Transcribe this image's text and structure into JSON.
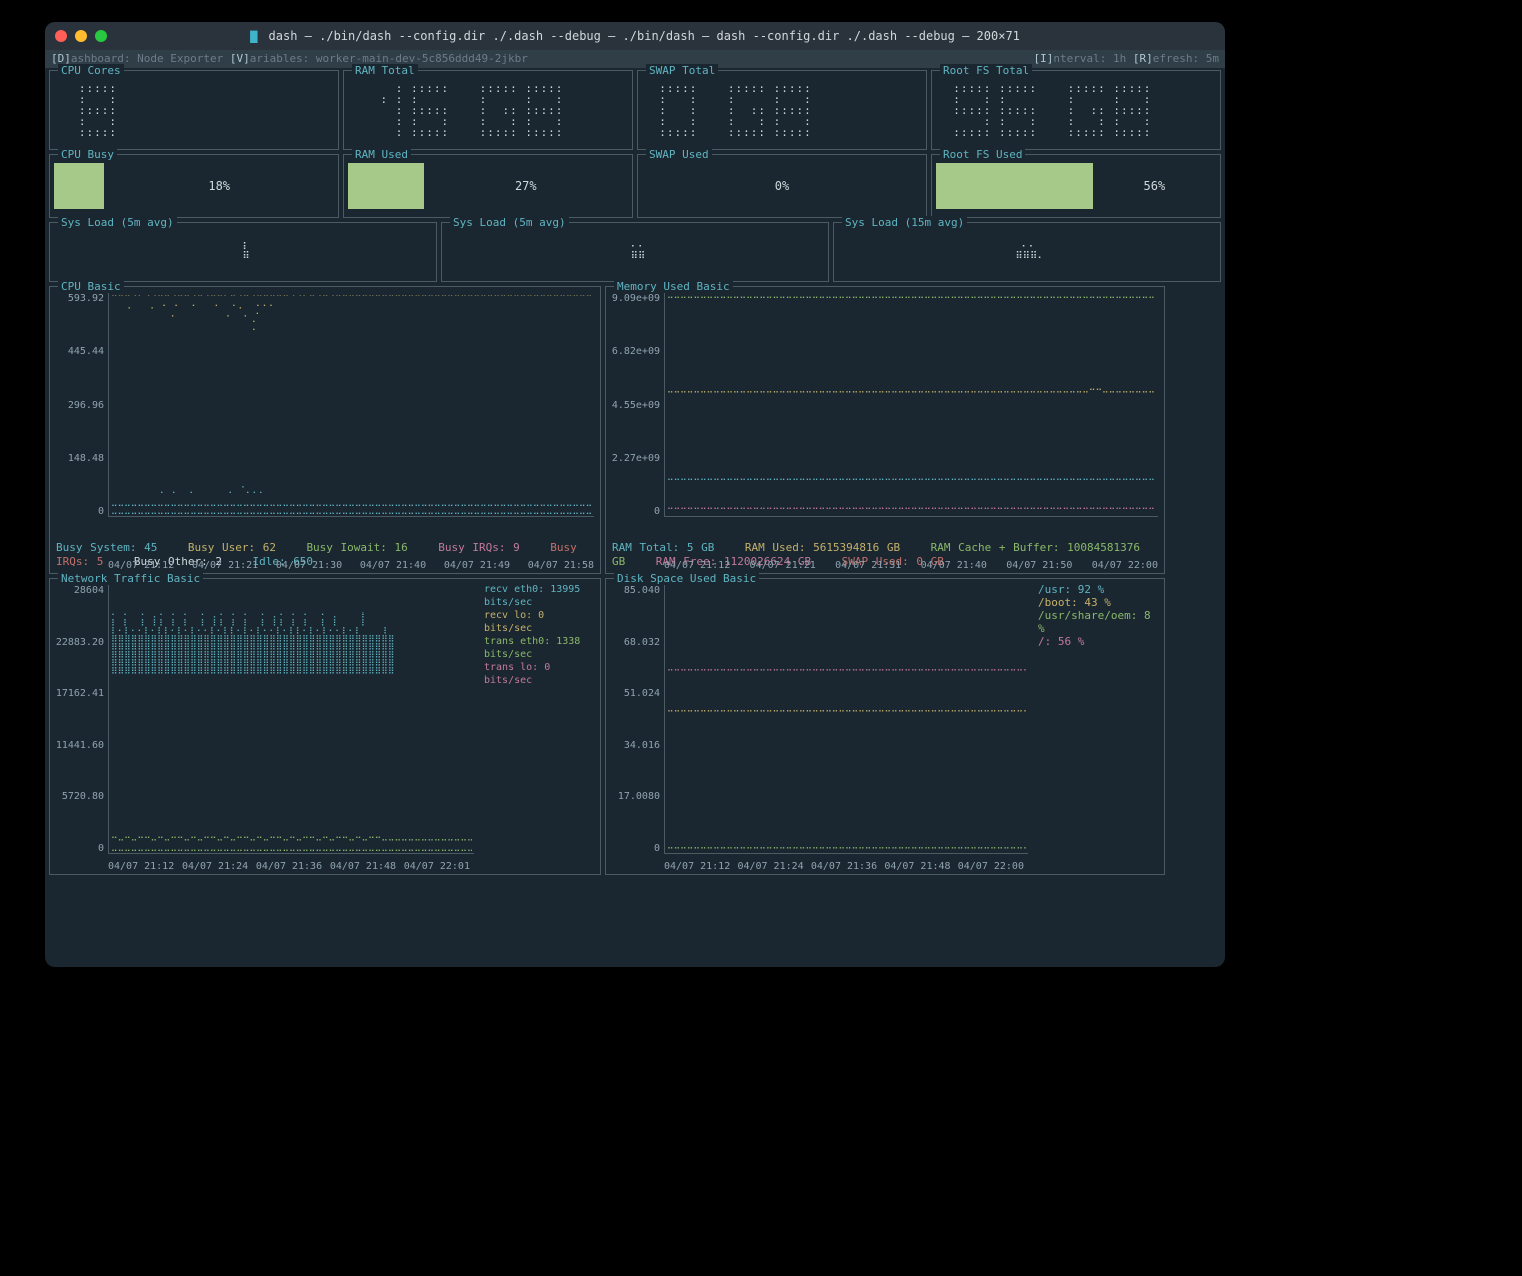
{
  "window": {
    "title": "dash — ./bin/dash --config.dir ./.dash --debug — ./bin/dash — dash --config.dir ./.dash --debug — 200×71"
  },
  "topbar": {
    "left_dashboard_key": "[D]",
    "left_dashboard": "ashboard: Node Exporter ",
    "left_variables_key": "[V]",
    "left_variables": "ariables: worker-main-dev-5c856ddd49-2jkbr",
    "right_interval_key": "[I]",
    "right_interval": "nterval: 1h ",
    "right_refresh_key": "[R]",
    "right_refresh": "efresh: 5m"
  },
  "big_panels": {
    "cpu_cores": {
      "title": "CPU Cores",
      "value": "8"
    },
    "ram_total": {
      "title": "RAM Total",
      "value": "16 GB"
    },
    "swap_total": {
      "title": "SWAP Total",
      "value": "0 GB"
    },
    "root_fs_total": {
      "title": "Root FS Total",
      "value": "96 GB"
    }
  },
  "gauges": {
    "cpu_busy": {
      "title": "CPU Busy",
      "pct": 18,
      "label": "18%"
    },
    "ram_used": {
      "title": "RAM Used",
      "pct": 27,
      "label": "27%"
    },
    "swap_used": {
      "title": "SWAP Used",
      "pct": 0,
      "label": "0%"
    },
    "root_fs_used": {
      "title": "Root FS Used",
      "pct": 56,
      "label": "56%"
    }
  },
  "sysload": {
    "a": {
      "title": "Sys Load (5m avg)"
    },
    "b": {
      "title": "Sys Load (5m avg)"
    },
    "c": {
      "title": "Sys Load (15m avg)"
    }
  },
  "cpu_basic": {
    "title": "CPU Basic",
    "y_ticks": [
      "593.92",
      "445.44",
      "296.96",
      "148.48",
      "0"
    ],
    "x_ticks": [
      "04/07 21:12",
      "04/07 21:21",
      "04/07 21:30",
      "04/07 21:40",
      "04/07 21:49",
      "04/07 21:58"
    ],
    "legend": [
      {
        "cls": "lg-cyan",
        "text": "Busy System: 45"
      },
      {
        "cls": "lg-yellow",
        "text": "Busy User: 62"
      },
      {
        "cls": "lg-green",
        "text": "Busy Iowait: 16"
      },
      {
        "cls": "lg-mag",
        "text": "Busy IRQs: 9"
      },
      {
        "cls": "lg-red",
        "text": "Busy IRQs: 5"
      },
      {
        "cls": "lg-white",
        "text": "Busy Other: 2"
      },
      {
        "cls": "lg-cyan",
        "text": "Idle: 650"
      }
    ]
  },
  "mem_basic": {
    "title": "Memory Used Basic",
    "y_ticks": [
      "9.09e+09",
      "6.82e+09",
      "4.55e+09",
      "2.27e+09",
      "0"
    ],
    "x_ticks": [
      "04/07 21:12",
      "04/07 21:21",
      "04/07 21:31",
      "04/07 21:40",
      "04/07 21:50",
      "04/07 22:00"
    ],
    "legend": [
      {
        "cls": "lg-cyan",
        "text": "RAM Total: 5 GB"
      },
      {
        "cls": "lg-yellow",
        "text": "RAM Used: 5615394816 GB"
      },
      {
        "cls": "lg-green",
        "text": "RAM Cache + Buffer: 10084581376 GB"
      },
      {
        "cls": "lg-mag",
        "text": "RAM Free: 1120026624 GB"
      },
      {
        "cls": "lg-red",
        "text": "SWAP Used: 0 GB"
      }
    ]
  },
  "net_basic": {
    "title": "Network Traffic Basic",
    "y_ticks": [
      "28604",
      "22883.20",
      "17162.41",
      "11441.60",
      "5720.80",
      "0"
    ],
    "x_ticks": [
      "04/07 21:12",
      "04/07 21:24",
      "04/07 21:36",
      "04/07 21:48",
      "04/07 22:01"
    ],
    "legend": [
      {
        "cls": "lg-cyan",
        "text": "recv eth0: 13995 bits/sec"
      },
      {
        "cls": "lg-yellow",
        "text": "recv lo: 0 bits/sec"
      },
      {
        "cls": "lg-green",
        "text": "trans eth0: 1338 bits/sec"
      },
      {
        "cls": "lg-mag",
        "text": "trans lo: 0 bits/sec"
      }
    ]
  },
  "disk_basic": {
    "title": "Disk Space Used Basic",
    "y_ticks": [
      "85.040",
      "68.032",
      "51.024",
      "34.016",
      "17.0080",
      "0"
    ],
    "x_ticks": [
      "04/07 21:12",
      "04/07 21:24",
      "04/07 21:36",
      "04/07 21:48",
      "04/07 22:00"
    ],
    "legend": [
      {
        "cls": "lg-cyan",
        "text": "/usr: 92 %"
      },
      {
        "cls": "lg-yellow",
        "text": "/boot: 43 %"
      },
      {
        "cls": "lg-green",
        "text": "/usr/share/oem: 8 %"
      },
      {
        "cls": "lg-mag",
        "text": "/: 56 %"
      }
    ]
  },
  "chart_data": [
    {
      "type": "line",
      "title": "CPU Basic",
      "xlabel": "",
      "ylabel": "",
      "ylim": [
        0,
        593.92
      ],
      "x": [
        "04/07 21:12",
        "04/07 21:21",
        "04/07 21:30",
        "04/07 21:40",
        "04/07 21:49",
        "04/07 21:58"
      ],
      "series": [
        {
          "name": "Busy System",
          "values": [
            45,
            45,
            45,
            45,
            45,
            45
          ]
        },
        {
          "name": "Busy User",
          "values": [
            62,
            62,
            62,
            62,
            62,
            62
          ]
        },
        {
          "name": "Busy Iowait",
          "values": [
            16,
            16,
            16,
            16,
            16,
            16
          ]
        },
        {
          "name": "Busy IRQs",
          "values": [
            9,
            9,
            9,
            9,
            9,
            9
          ]
        },
        {
          "name": "Busy IRQs2",
          "values": [
            5,
            5,
            5,
            5,
            5,
            5
          ]
        },
        {
          "name": "Busy Other",
          "values": [
            2,
            2,
            2,
            2,
            2,
            2
          ]
        },
        {
          "name": "Idle",
          "values": [
            650,
            580,
            560,
            540,
            590,
            590
          ]
        }
      ]
    },
    {
      "type": "line",
      "title": "Memory Used Basic",
      "ylim": [
        0,
        9090000000.0
      ],
      "x": [
        "04/07 21:12",
        "04/07 21:21",
        "04/07 21:31",
        "04/07 21:40",
        "04/07 21:50",
        "04/07 22:00"
      ],
      "series": [
        {
          "name": "RAM Total",
          "values": [
            5000000000.0,
            5000000000.0,
            5000000000.0,
            5000000000.0,
            5000000000.0,
            5000000000.0
          ]
        },
        {
          "name": "RAM Used",
          "values": [
            5600000000.0,
            5600000000.0,
            5600000000.0,
            5600000000.0,
            5600000000.0,
            5600000000.0
          ]
        },
        {
          "name": "RAM Cache + Buffer",
          "values": [
            10000000000.0,
            10000000000.0,
            10000000000.0,
            10000000000.0,
            10000000000.0,
            10000000000.0
          ]
        },
        {
          "name": "RAM Free",
          "values": [
            1120000000.0,
            1120000000.0,
            1120000000.0,
            1120000000.0,
            1120000000.0,
            1120000000.0
          ]
        },
        {
          "name": "SWAP Used",
          "values": [
            0,
            0,
            0,
            0,
            0,
            0
          ]
        }
      ]
    },
    {
      "type": "line",
      "title": "Network Traffic Basic",
      "ylim": [
        0,
        28604
      ],
      "x": [
        "04/07 21:12",
        "04/07 21:24",
        "04/07 21:36",
        "04/07 21:48",
        "04/07 22:01"
      ],
      "series": [
        {
          "name": "recv eth0",
          "values": [
            13995,
            22000,
            18000,
            20000,
            13995
          ]
        },
        {
          "name": "recv lo",
          "values": [
            0,
            0,
            0,
            0,
            0
          ]
        },
        {
          "name": "trans eth0",
          "values": [
            1338,
            1400,
            1500,
            1200,
            1338
          ]
        },
        {
          "name": "trans lo",
          "values": [
            0,
            0,
            0,
            0,
            0
          ]
        }
      ]
    },
    {
      "type": "line",
      "title": "Disk Space Used Basic",
      "ylim": [
        0,
        85.04
      ],
      "x": [
        "04/07 21:12",
        "04/07 21:24",
        "04/07 21:36",
        "04/07 21:48",
        "04/07 22:00"
      ],
      "series": [
        {
          "name": "/usr",
          "values": [
            92,
            92,
            92,
            92,
            92
          ]
        },
        {
          "name": "/boot",
          "values": [
            43,
            43,
            43,
            43,
            43
          ]
        },
        {
          "name": "/usr/share/oem",
          "values": [
            8,
            8,
            8,
            8,
            8
          ]
        },
        {
          "name": "/",
          "values": [
            56,
            56,
            56,
            56,
            56
          ]
        }
      ]
    }
  ]
}
